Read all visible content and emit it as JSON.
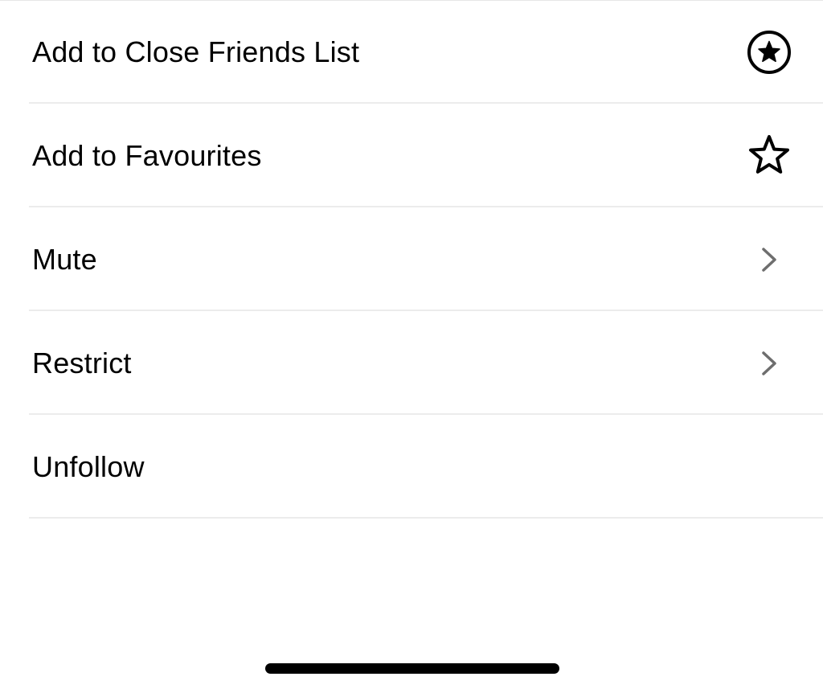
{
  "menu": {
    "items": [
      {
        "label": "Add to Close Friends List",
        "icon": "close-friends-star-circle-icon",
        "accessory": "icon"
      },
      {
        "label": "Add to Favourites",
        "icon": "star-outline-icon",
        "accessory": "icon"
      },
      {
        "label": "Mute",
        "icon": "chevron-right-icon",
        "accessory": "chevron"
      },
      {
        "label": "Restrict",
        "icon": "chevron-right-icon",
        "accessory": "chevron"
      },
      {
        "label": "Unfollow",
        "icon": null,
        "accessory": "none"
      }
    ]
  },
  "colors": {
    "text": "#000000",
    "divider": "#ececec",
    "chevron": "#6e6e6e",
    "background": "#ffffff"
  }
}
